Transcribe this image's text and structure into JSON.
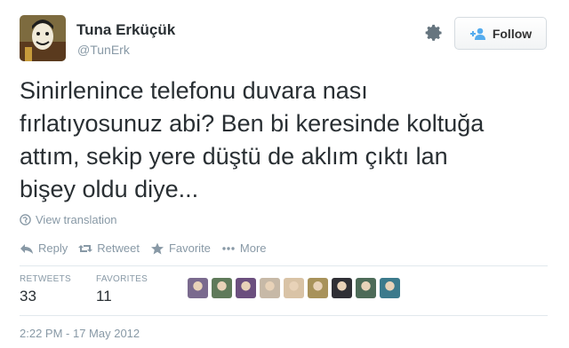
{
  "author": {
    "name": "Tuna Erküçük",
    "handle": "@TunErk"
  },
  "header": {
    "follow_label": "Follow",
    "settings_icon": "gear-icon",
    "follow_icon": "add-user-icon"
  },
  "tweet": {
    "lines": [
      "Sinirlenince telefonu duvara nası",
      "fırlatıyosunuz abi? Ben bi keresinde koltuğa",
      "attım, sekip yere düştü de aklım çıktı lan",
      "bişey oldu diye..."
    ],
    "view_translation": "View translation"
  },
  "actions": [
    {
      "label": "Reply",
      "icon": "reply-icon"
    },
    {
      "label": "Retweet",
      "icon": "retweet-icon"
    },
    {
      "label": "Favorite",
      "icon": "star-icon"
    },
    {
      "label": "More",
      "icon": "ellipsis-icon"
    }
  ],
  "stats": {
    "retweets_label": "RETWEETS",
    "retweets_value": "33",
    "favorites_label": "FAVORITES",
    "favorites_value": "11"
  },
  "favoriters": [
    {
      "color": "#7a6a8e"
    },
    {
      "color": "#5f7a5a"
    },
    {
      "color": "#6b4f7e"
    },
    {
      "color": "#c7b9a7"
    },
    {
      "color": "#d9c3a6"
    },
    {
      "color": "#a8925a"
    },
    {
      "color": "#2f2f35"
    },
    {
      "color": "#4d6b58"
    },
    {
      "color": "#3c7a8c"
    }
  ],
  "timestamp": "2:22 PM - 17 May 2012",
  "colors": {
    "text": "#292f33",
    "muted": "#8899a6",
    "divider": "#e1e8ed"
  }
}
